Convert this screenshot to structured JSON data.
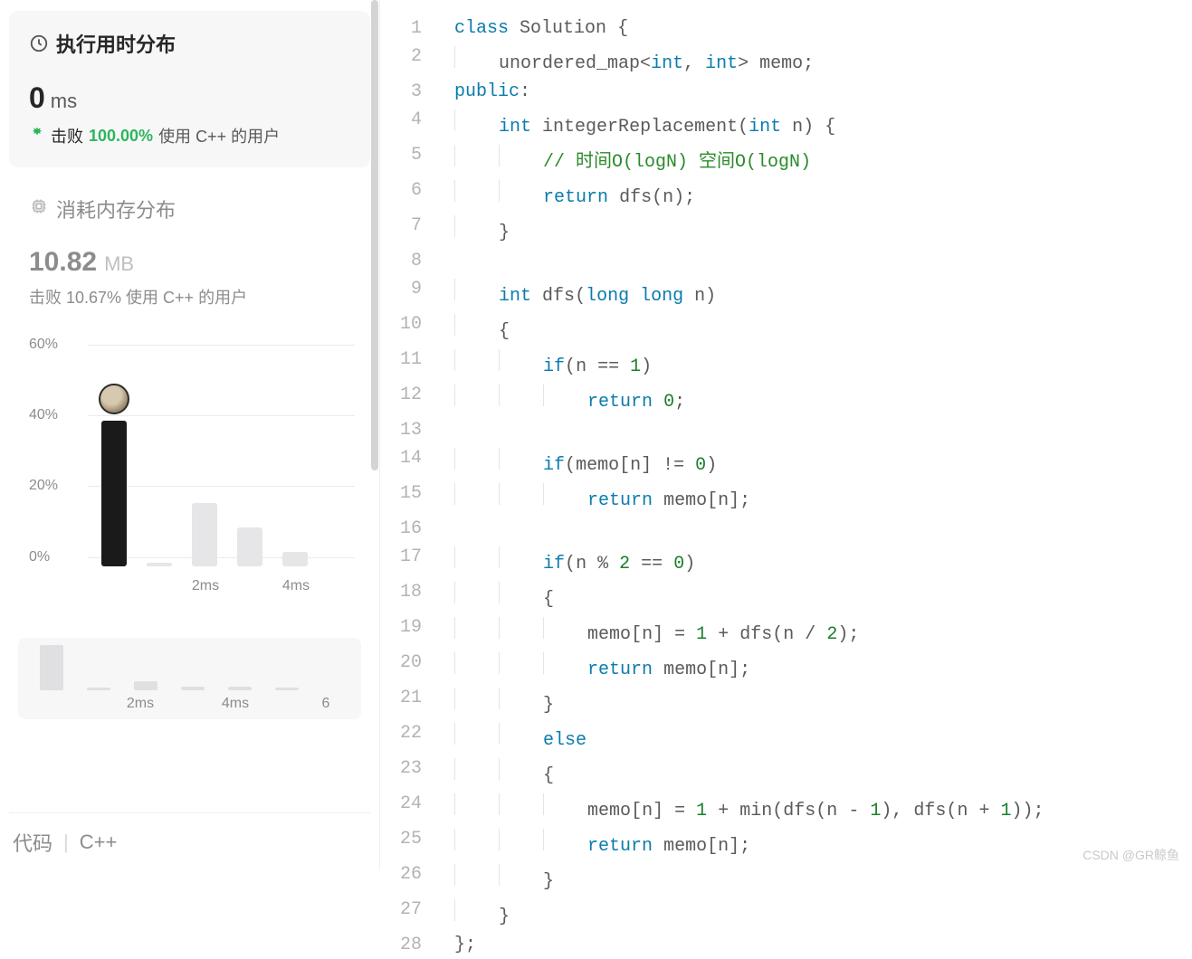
{
  "runtime_card": {
    "title": "执行用时分布",
    "value": "0",
    "unit": "ms",
    "beat_prefix": "击败",
    "beat_percent": "100.00%",
    "beat_suffix": "使用 C++ 的用户"
  },
  "memory_card": {
    "title": "消耗内存分布",
    "value": "10.82",
    "unit": "MB",
    "beat_line": "击败 10.67% 使用 C++ 的用户"
  },
  "chart_data": {
    "type": "bar",
    "ylabel": "",
    "xlabel": "",
    "ylim": [
      0,
      60
    ],
    "yticks": [
      "60%",
      "40%",
      "20%",
      "0%"
    ],
    "xticks": [
      "2ms",
      "4ms"
    ],
    "series": [
      {
        "name": "runtime-distribution",
        "categories": [
          "0ms",
          "1ms",
          "2ms",
          "3ms",
          "4ms",
          "5ms"
        ],
        "values": [
          41,
          1,
          18,
          11,
          4,
          0
        ],
        "highlight_index": 0
      }
    ],
    "mini": {
      "xticks": [
        "2ms",
        "4ms",
        "6"
      ],
      "values": [
        46,
        2,
        9,
        4,
        4,
        1
      ]
    }
  },
  "bottom_bar": {
    "left": "代码",
    "right": "C++"
  },
  "code": {
    "lines": [
      [
        {
          "t": "kw",
          "v": "class"
        },
        {
          "t": "sp",
          "v": " "
        },
        {
          "t": "id",
          "v": "Solution"
        },
        {
          "t": "sp",
          "v": " "
        },
        {
          "t": "punc",
          "v": "{"
        }
      ],
      [
        {
          "t": "in",
          "v": 1
        },
        {
          "t": "id",
          "v": "unordered_map"
        },
        {
          "t": "punc",
          "v": "<"
        },
        {
          "t": "kw",
          "v": "int"
        },
        {
          "t": "punc",
          "v": ","
        },
        {
          "t": "sp",
          "v": " "
        },
        {
          "t": "kw",
          "v": "int"
        },
        {
          "t": "punc",
          "v": ">"
        },
        {
          "t": "sp",
          "v": " "
        },
        {
          "t": "id",
          "v": "memo"
        },
        {
          "t": "punc",
          "v": ";"
        }
      ],
      [
        {
          "t": "kw",
          "v": "public"
        },
        {
          "t": "punc",
          "v": ":"
        }
      ],
      [
        {
          "t": "in",
          "v": 1
        },
        {
          "t": "kw",
          "v": "int"
        },
        {
          "t": "sp",
          "v": " "
        },
        {
          "t": "id",
          "v": "integerReplacement"
        },
        {
          "t": "punc",
          "v": "("
        },
        {
          "t": "kw",
          "v": "int"
        },
        {
          "t": "sp",
          "v": " "
        },
        {
          "t": "id",
          "v": "n"
        },
        {
          "t": "punc",
          "v": ")"
        },
        {
          "t": "sp",
          "v": " "
        },
        {
          "t": "punc",
          "v": "{"
        }
      ],
      [
        {
          "t": "in",
          "v": 2
        },
        {
          "t": "cm",
          "v": "// 时间O(logN) 空间O(logN)"
        }
      ],
      [
        {
          "t": "in",
          "v": 2
        },
        {
          "t": "kw",
          "v": "return"
        },
        {
          "t": "sp",
          "v": " "
        },
        {
          "t": "id",
          "v": "dfs"
        },
        {
          "t": "punc",
          "v": "("
        },
        {
          "t": "id",
          "v": "n"
        },
        {
          "t": "punc",
          "v": ")"
        },
        {
          "t": "punc",
          "v": ";"
        }
      ],
      [
        {
          "t": "in",
          "v": 1
        },
        {
          "t": "punc",
          "v": "}"
        }
      ],
      [],
      [
        {
          "t": "in",
          "v": 1
        },
        {
          "t": "kw",
          "v": "int"
        },
        {
          "t": "sp",
          "v": " "
        },
        {
          "t": "id",
          "v": "dfs"
        },
        {
          "t": "punc",
          "v": "("
        },
        {
          "t": "kw",
          "v": "long"
        },
        {
          "t": "sp",
          "v": " "
        },
        {
          "t": "kw",
          "v": "long"
        },
        {
          "t": "sp",
          "v": " "
        },
        {
          "t": "id",
          "v": "n"
        },
        {
          "t": "punc",
          "v": ")"
        }
      ],
      [
        {
          "t": "in",
          "v": 1
        },
        {
          "t": "punc",
          "v": "{"
        }
      ],
      [
        {
          "t": "in",
          "v": 2
        },
        {
          "t": "kw",
          "v": "if"
        },
        {
          "t": "punc",
          "v": "("
        },
        {
          "t": "id",
          "v": "n"
        },
        {
          "t": "sp",
          "v": " "
        },
        {
          "t": "op",
          "v": "=="
        },
        {
          "t": "sp",
          "v": " "
        },
        {
          "t": "num",
          "v": "1"
        },
        {
          "t": "punc",
          "v": ")"
        }
      ],
      [
        {
          "t": "in",
          "v": 3
        },
        {
          "t": "kw",
          "v": "return"
        },
        {
          "t": "sp",
          "v": " "
        },
        {
          "t": "num",
          "v": "0"
        },
        {
          "t": "punc",
          "v": ";"
        }
      ],
      [],
      [
        {
          "t": "in",
          "v": 2
        },
        {
          "t": "kw",
          "v": "if"
        },
        {
          "t": "punc",
          "v": "("
        },
        {
          "t": "id",
          "v": "memo"
        },
        {
          "t": "punc",
          "v": "["
        },
        {
          "t": "id",
          "v": "n"
        },
        {
          "t": "punc",
          "v": "]"
        },
        {
          "t": "sp",
          "v": " "
        },
        {
          "t": "op",
          "v": "!="
        },
        {
          "t": "sp",
          "v": " "
        },
        {
          "t": "num",
          "v": "0"
        },
        {
          "t": "punc",
          "v": ")"
        }
      ],
      [
        {
          "t": "in",
          "v": 3
        },
        {
          "t": "kw",
          "v": "return"
        },
        {
          "t": "sp",
          "v": " "
        },
        {
          "t": "id",
          "v": "memo"
        },
        {
          "t": "punc",
          "v": "["
        },
        {
          "t": "id",
          "v": "n"
        },
        {
          "t": "punc",
          "v": "]"
        },
        {
          "t": "punc",
          "v": ";"
        }
      ],
      [],
      [
        {
          "t": "in",
          "v": 2
        },
        {
          "t": "kw",
          "v": "if"
        },
        {
          "t": "punc",
          "v": "("
        },
        {
          "t": "id",
          "v": "n"
        },
        {
          "t": "sp",
          "v": " "
        },
        {
          "t": "op",
          "v": "%"
        },
        {
          "t": "sp",
          "v": " "
        },
        {
          "t": "num",
          "v": "2"
        },
        {
          "t": "sp",
          "v": " "
        },
        {
          "t": "op",
          "v": "=="
        },
        {
          "t": "sp",
          "v": " "
        },
        {
          "t": "num",
          "v": "0"
        },
        {
          "t": "punc",
          "v": ")"
        }
      ],
      [
        {
          "t": "in",
          "v": 2
        },
        {
          "t": "punc",
          "v": "{"
        }
      ],
      [
        {
          "t": "in",
          "v": 3
        },
        {
          "t": "id",
          "v": "memo"
        },
        {
          "t": "punc",
          "v": "["
        },
        {
          "t": "id",
          "v": "n"
        },
        {
          "t": "punc",
          "v": "]"
        },
        {
          "t": "sp",
          "v": " "
        },
        {
          "t": "op",
          "v": "="
        },
        {
          "t": "sp",
          "v": " "
        },
        {
          "t": "num",
          "v": "1"
        },
        {
          "t": "sp",
          "v": " "
        },
        {
          "t": "op",
          "v": "+"
        },
        {
          "t": "sp",
          "v": " "
        },
        {
          "t": "id",
          "v": "dfs"
        },
        {
          "t": "punc",
          "v": "("
        },
        {
          "t": "id",
          "v": "n"
        },
        {
          "t": "sp",
          "v": " "
        },
        {
          "t": "op",
          "v": "/"
        },
        {
          "t": "sp",
          "v": " "
        },
        {
          "t": "num",
          "v": "2"
        },
        {
          "t": "punc",
          "v": ")"
        },
        {
          "t": "punc",
          "v": ";"
        }
      ],
      [
        {
          "t": "in",
          "v": 3
        },
        {
          "t": "kw",
          "v": "return"
        },
        {
          "t": "sp",
          "v": " "
        },
        {
          "t": "id",
          "v": "memo"
        },
        {
          "t": "punc",
          "v": "["
        },
        {
          "t": "id",
          "v": "n"
        },
        {
          "t": "punc",
          "v": "]"
        },
        {
          "t": "punc",
          "v": ";"
        }
      ],
      [
        {
          "t": "in",
          "v": 2
        },
        {
          "t": "punc",
          "v": "}"
        }
      ],
      [
        {
          "t": "in",
          "v": 2
        },
        {
          "t": "kw",
          "v": "else"
        }
      ],
      [
        {
          "t": "in",
          "v": 2
        },
        {
          "t": "punc",
          "v": "{"
        }
      ],
      [
        {
          "t": "in",
          "v": 3
        },
        {
          "t": "id",
          "v": "memo"
        },
        {
          "t": "punc",
          "v": "["
        },
        {
          "t": "id",
          "v": "n"
        },
        {
          "t": "punc",
          "v": "]"
        },
        {
          "t": "sp",
          "v": " "
        },
        {
          "t": "op",
          "v": "="
        },
        {
          "t": "sp",
          "v": " "
        },
        {
          "t": "num",
          "v": "1"
        },
        {
          "t": "sp",
          "v": " "
        },
        {
          "t": "op",
          "v": "+"
        },
        {
          "t": "sp",
          "v": " "
        },
        {
          "t": "id",
          "v": "min"
        },
        {
          "t": "punc",
          "v": "("
        },
        {
          "t": "id",
          "v": "dfs"
        },
        {
          "t": "punc",
          "v": "("
        },
        {
          "t": "id",
          "v": "n"
        },
        {
          "t": "sp",
          "v": " "
        },
        {
          "t": "op",
          "v": "-"
        },
        {
          "t": "sp",
          "v": " "
        },
        {
          "t": "num",
          "v": "1"
        },
        {
          "t": "punc",
          "v": ")"
        },
        {
          "t": "punc",
          "v": ","
        },
        {
          "t": "sp",
          "v": " "
        },
        {
          "t": "id",
          "v": "dfs"
        },
        {
          "t": "punc",
          "v": "("
        },
        {
          "t": "id",
          "v": "n"
        },
        {
          "t": "sp",
          "v": " "
        },
        {
          "t": "op",
          "v": "+"
        },
        {
          "t": "sp",
          "v": " "
        },
        {
          "t": "num",
          "v": "1"
        },
        {
          "t": "punc",
          "v": ")"
        },
        {
          "t": "punc",
          "v": ")"
        },
        {
          "t": "punc",
          "v": ";"
        }
      ],
      [
        {
          "t": "in",
          "v": 3
        },
        {
          "t": "kw",
          "v": "return"
        },
        {
          "t": "sp",
          "v": " "
        },
        {
          "t": "id",
          "v": "memo"
        },
        {
          "t": "punc",
          "v": "["
        },
        {
          "t": "id",
          "v": "n"
        },
        {
          "t": "punc",
          "v": "]"
        },
        {
          "t": "punc",
          "v": ";"
        }
      ],
      [
        {
          "t": "in",
          "v": 2
        },
        {
          "t": "punc",
          "v": "}"
        }
      ],
      [
        {
          "t": "in",
          "v": 1
        },
        {
          "t": "punc",
          "v": "}"
        }
      ],
      [
        {
          "t": "punc",
          "v": "};"
        }
      ]
    ]
  },
  "watermark": "CSDN @GR鲸鱼"
}
